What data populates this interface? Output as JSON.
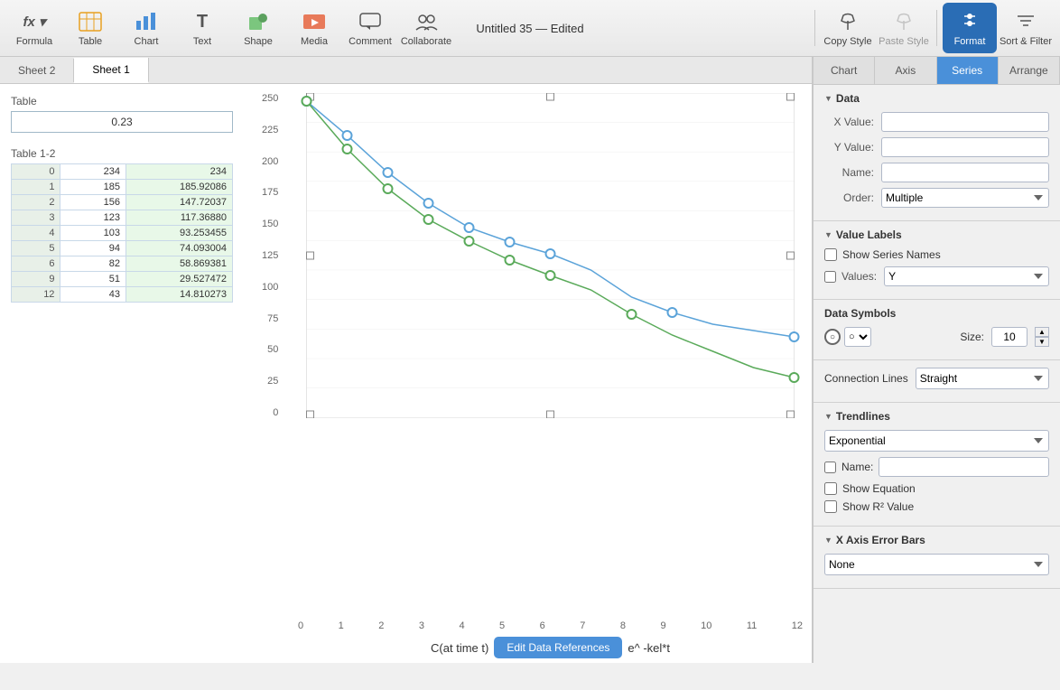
{
  "window": {
    "title": "Untitled 35 — Edited"
  },
  "toolbar": {
    "title": "Untitled 35 — Edited",
    "edited_label": "Edited",
    "buttons": [
      {
        "id": "formula",
        "label": "Formula",
        "icon": "fx"
      },
      {
        "id": "table",
        "label": "Table",
        "icon": "table"
      },
      {
        "id": "chart",
        "label": "Chart",
        "icon": "chart"
      },
      {
        "id": "text",
        "label": "Text",
        "icon": "T"
      },
      {
        "id": "shape",
        "label": "Shape",
        "icon": "shape"
      },
      {
        "id": "media",
        "label": "Media",
        "icon": "media"
      },
      {
        "id": "comment",
        "label": "Comment",
        "icon": "comment"
      },
      {
        "id": "collaborate",
        "label": "Collaborate",
        "icon": "collaborate"
      },
      {
        "id": "copy_style",
        "label": "Copy Style",
        "icon": "copy-style"
      },
      {
        "id": "paste_style",
        "label": "Paste Style",
        "icon": "paste-style"
      },
      {
        "id": "format",
        "label": "Format",
        "icon": "format"
      },
      {
        "id": "sort_filter",
        "label": "Sort & Filter",
        "icon": "sort-filter"
      }
    ]
  },
  "sheets": [
    {
      "id": "sheet2",
      "label": "Sheet 2",
      "active": false
    },
    {
      "id": "sheet1",
      "label": "Sheet 1",
      "active": true
    }
  ],
  "left_table": {
    "label": "Table",
    "cell_value": "0.23"
  },
  "table12": {
    "label": "Table 1-2",
    "rows": [
      {
        "row": "0",
        "col1": "234",
        "col2": "234"
      },
      {
        "row": "1",
        "col1": "185",
        "col2": "185.92086"
      },
      {
        "row": "2",
        "col1": "156",
        "col2": "147.72037"
      },
      {
        "row": "3",
        "col1": "123",
        "col2": "117.36880"
      },
      {
        "row": "4",
        "col1": "103",
        "col2": "93.253455"
      },
      {
        "row": "5",
        "col1": "94",
        "col2": "74.093004"
      },
      {
        "row": "6",
        "col1": "82",
        "col2": "58.869381"
      },
      {
        "row": "9",
        "col1": "51",
        "col2": "29.527472"
      },
      {
        "row": "12",
        "col1": "43",
        "col2": "14.810273"
      }
    ]
  },
  "chart": {
    "y_labels": [
      "250",
      "225",
      "200",
      "175",
      "150",
      "125",
      "100",
      "75",
      "50",
      "25",
      "0"
    ],
    "x_labels": [
      "0",
      "1",
      "2",
      "3",
      "4",
      "5",
      "6",
      "7",
      "8",
      "9",
      "10",
      "11",
      "12"
    ],
    "formula": "C(at time t)",
    "formula_mid": "Edit Data References",
    "formula_end": "e^ -kel*t"
  },
  "right_panel": {
    "tabs": [
      "Chart",
      "Axis",
      "Series",
      "Arrange"
    ],
    "active_tab": "Series",
    "data_section": {
      "label": "Data",
      "x_value_label": "X Value:",
      "x_value": "",
      "y_value_label": "Y Value:",
      "y_value": "",
      "name_label": "Name:",
      "name": "",
      "order_label": "Order:",
      "order_value": "Multiple"
    },
    "value_labels_section": {
      "label": "Value Labels",
      "show_series_names_label": "Show Series Names",
      "show_series_names_checked": false,
      "values_label": "Values:",
      "values_option": "Y"
    },
    "data_symbols_section": {
      "label": "Data Symbols",
      "symbol": "○",
      "size_label": "Size:",
      "size_value": "10"
    },
    "connection_lines_section": {
      "label": "Connection Lines",
      "option": "Straight"
    },
    "trendlines_section": {
      "label": "Trendlines",
      "option": "Exponential",
      "name_label": "Name:",
      "name": "",
      "show_equation_label": "Show Equation",
      "show_equation_checked": false,
      "show_r2_label": "Show R² Value",
      "show_r2_checked": false
    },
    "x_axis_error_bars_section": {
      "label": "X Axis Error Bars",
      "option": "None"
    },
    "edit_data_btn": "Edit Data References"
  }
}
